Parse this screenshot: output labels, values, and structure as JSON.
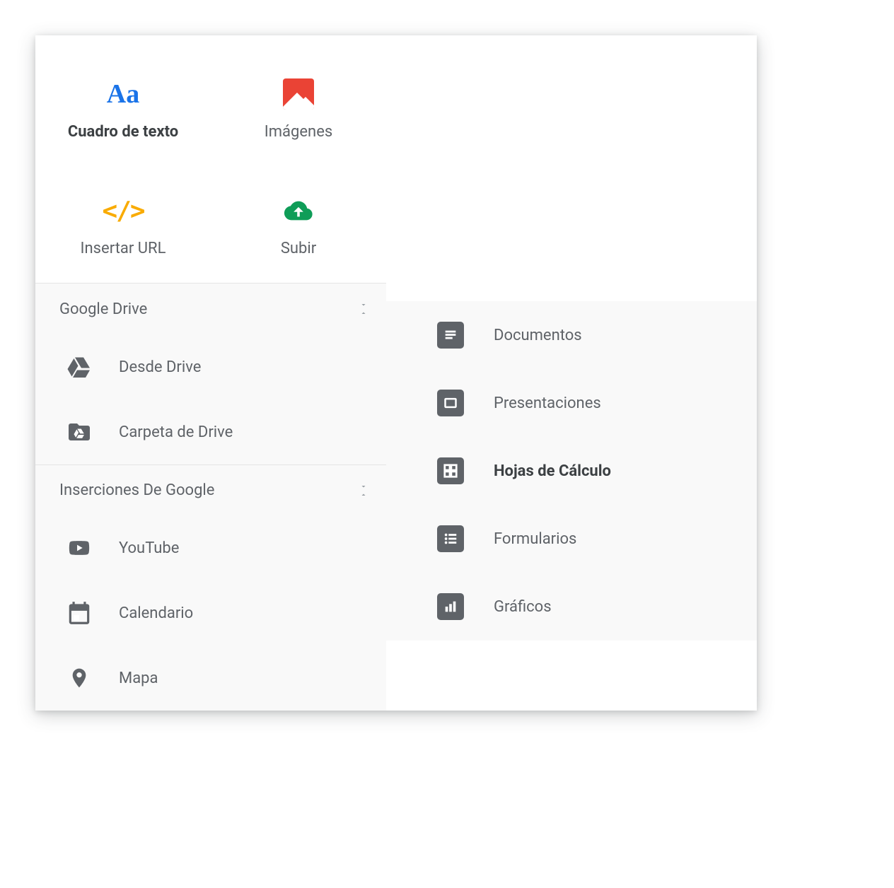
{
  "top": [
    {
      "key": "textbox",
      "label": "Cuadro de texto",
      "selected": true
    },
    {
      "key": "images",
      "label": "Imágenes",
      "selected": false
    },
    {
      "key": "url",
      "label": "Insertar URL",
      "selected": false
    },
    {
      "key": "upload",
      "label": "Subir",
      "selected": false
    }
  ],
  "sections": {
    "drive": {
      "title": "Google Drive",
      "items": [
        {
          "key": "from-drive",
          "label": "Desde Drive"
        },
        {
          "key": "drive-folder",
          "label": "Carpeta de Drive"
        }
      ]
    },
    "google": {
      "title": "Inserciones De Google",
      "items": [
        {
          "key": "youtube",
          "label": "YouTube"
        },
        {
          "key": "calendar",
          "label": "Calendario"
        },
        {
          "key": "map",
          "label": "Mapa"
        }
      ]
    }
  },
  "submenu": [
    {
      "key": "docs",
      "label": "Documentos",
      "active": false
    },
    {
      "key": "slides",
      "label": "Presentaciones",
      "active": false
    },
    {
      "key": "sheets",
      "label": "Hojas de Cálculo",
      "active": true
    },
    {
      "key": "forms",
      "label": "Formularios",
      "active": false
    },
    {
      "key": "charts",
      "label": "Gráficos",
      "active": false
    }
  ]
}
